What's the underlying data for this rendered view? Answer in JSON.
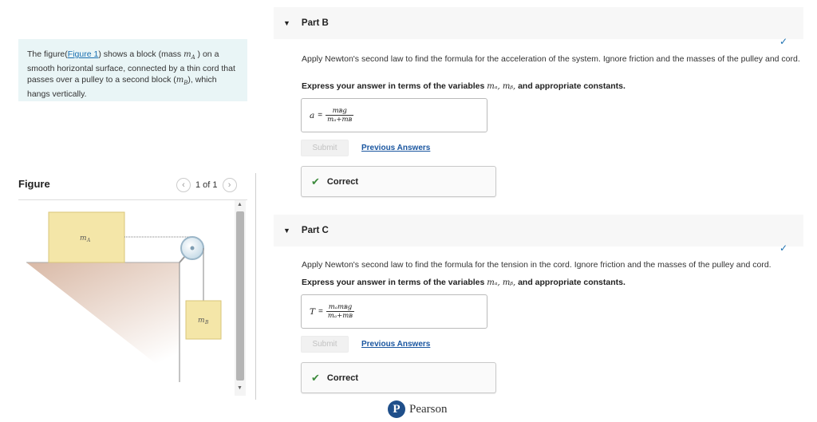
{
  "intro": {
    "text_before_link": "The figure(",
    "link_text": "Figure 1",
    "text_after_link": ") shows a block (mass ",
    "mass_a": "m",
    "mass_a_sub": "A",
    "text_after_mass_a": " ) on a smooth horizontal surface, connected by a thin cord that passes over a pulley to a second block (",
    "mass_b": "m",
    "mass_b_sub": "B",
    "text_end": "), which hangs vertically."
  },
  "figure_panel": {
    "title": "Figure",
    "pager_text": "1 of 1",
    "prev_icon": "chevron-left-icon",
    "next_icon": "chevron-right-icon",
    "block_a_label": "m",
    "block_a_sub": "A",
    "block_b_label": "m",
    "block_b_sub": "B"
  },
  "part_b": {
    "title": "Part B",
    "question": "Apply Newton's second law to find the formula for the acceleration of the system. Ignore friction and the masses of the pulley and cord.",
    "instruction_before": "Express your answer in terms of the variables ",
    "instruction_vars": "mₐ, mᵦ,",
    "instruction_after": " and appropriate constants.",
    "answer_var": "a",
    "answer_eq": "=",
    "answer_num": "mʙg",
    "answer_den": "mₐ+mʙ",
    "submit_label": "Submit",
    "prev_answers_label": "Previous Answers",
    "result": "Correct"
  },
  "part_c": {
    "title": "Part C",
    "question": "Apply Newton's second law to find the formula for the tension in the cord. Ignore friction and the masses of the pulley and cord.",
    "instruction_before": "Express your answer in terms of the variables ",
    "instruction_vars": "mₐ, mᵦ,",
    "instruction_after": " and appropriate constants.",
    "answer_var": "T",
    "answer_eq": "=",
    "answer_num": "mₐmʙg",
    "answer_den": "mₐ+mʙ",
    "submit_label": "Submit",
    "prev_answers_label": "Previous Answers",
    "result": "Correct"
  },
  "footer": {
    "brand_letter": "P",
    "brand": "Pearson"
  },
  "colors": {
    "intro_bg": "#e9f5f6",
    "link": "#1a6fb0",
    "correct_green": "#3d8b3d",
    "block_fill": "#f4e6a8",
    "ramp_fill": "#d9b9a6"
  }
}
